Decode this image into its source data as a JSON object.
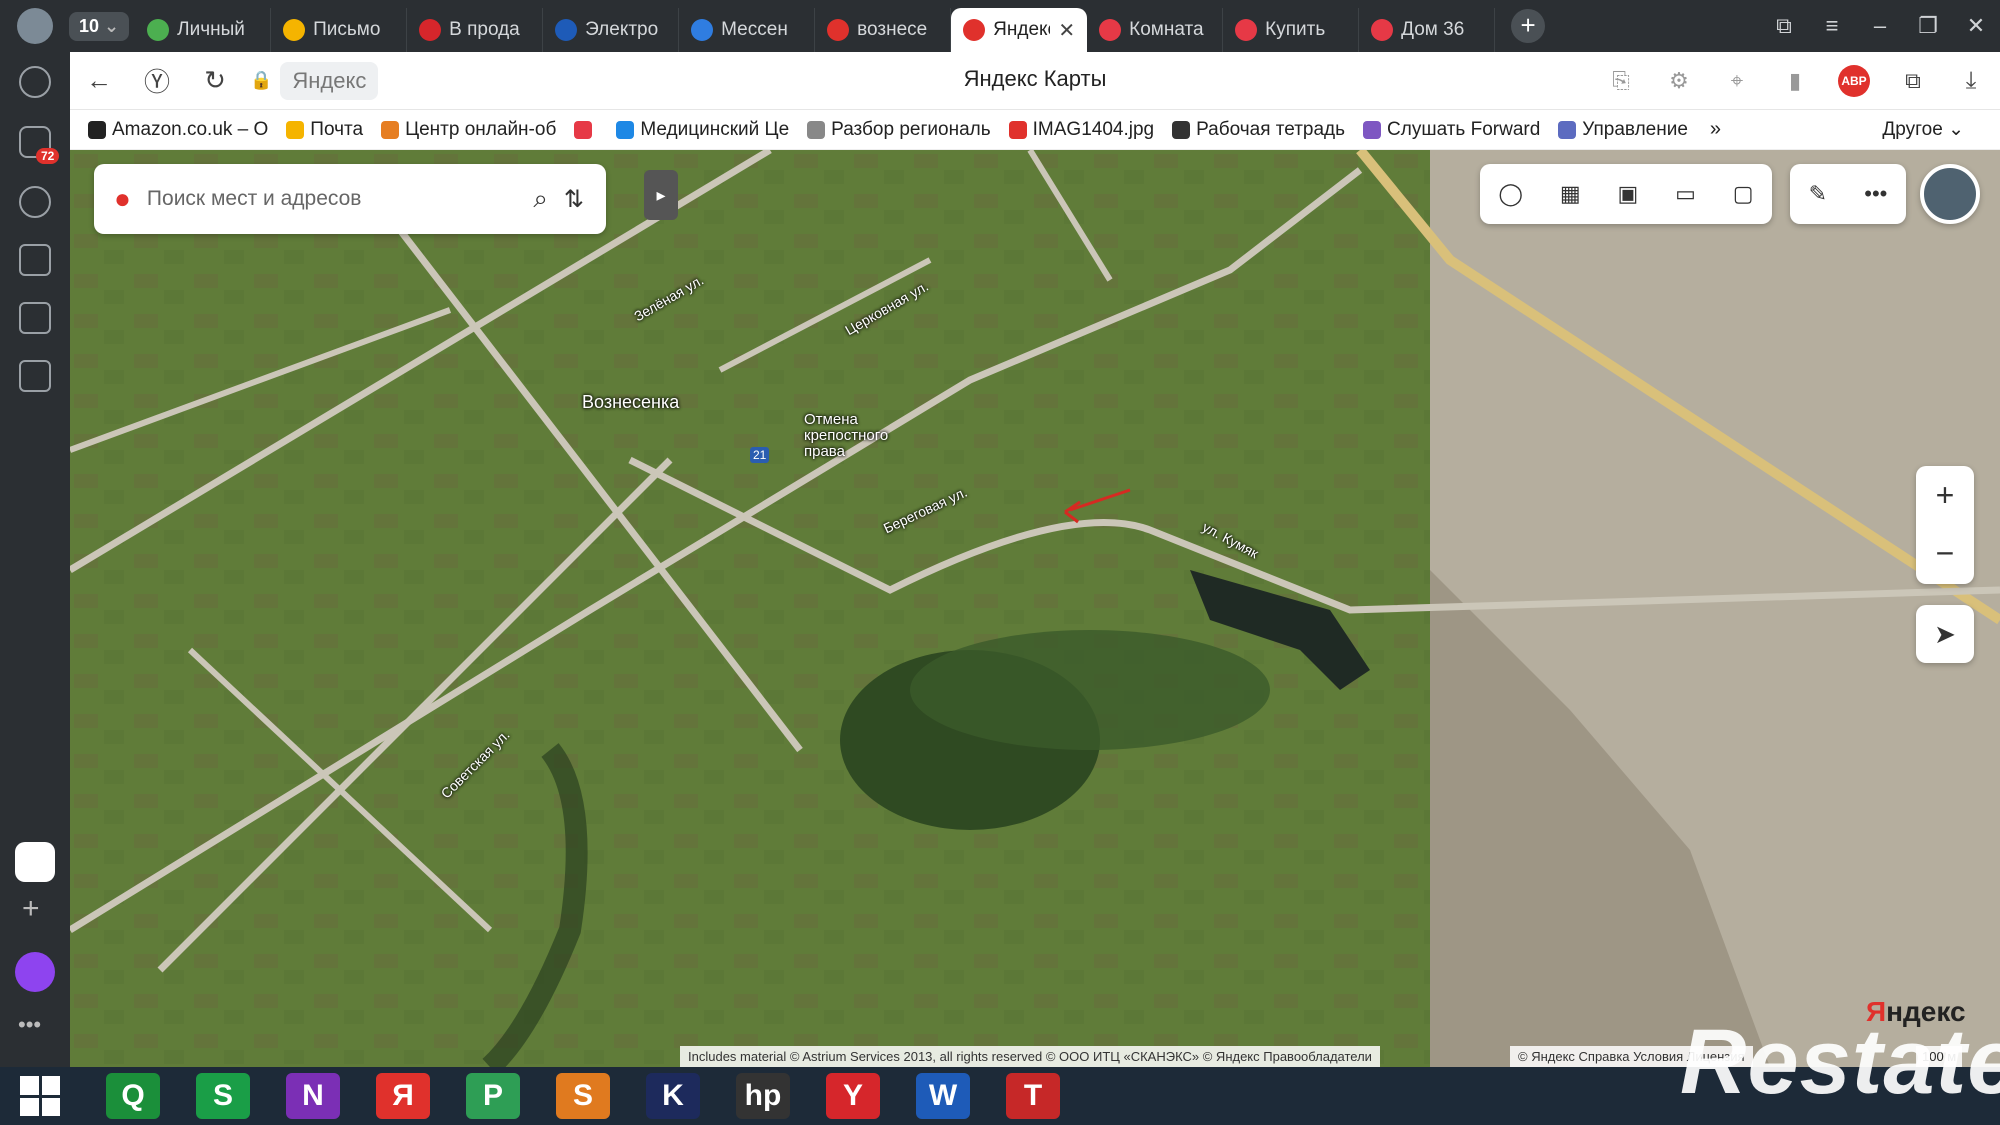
{
  "window": {
    "tab_count": "10"
  },
  "tabs": [
    {
      "label": "Личный",
      "color": "#4caf50"
    },
    {
      "label": "Письмо",
      "color": "#f5b400"
    },
    {
      "label": "В прода",
      "color": "#d6262b"
    },
    {
      "label": "Электро",
      "color": "#1e5bb8"
    },
    {
      "label": "Мессен",
      "color": "#2f7de1"
    },
    {
      "label": "вознесе",
      "color": "#e0312c"
    },
    {
      "label": "Яндекс",
      "color": "#e0312c",
      "active": true
    },
    {
      "label": "Комната",
      "color": "#e63946"
    },
    {
      "label": "Купить",
      "color": "#e63946"
    },
    {
      "label": "Дом 36",
      "color": "#e63946"
    }
  ],
  "address": {
    "url": "Яндекс",
    "title": "Яндекс Карты"
  },
  "bookmarks": [
    {
      "label": "Amazon.co.uk – O",
      "color": "#222222"
    },
    {
      "label": "Почта",
      "color": "#f5b400"
    },
    {
      "label": "Центр онлайн-об",
      "color": "#e67e22"
    },
    {
      "label": "",
      "color": "#e63946"
    },
    {
      "label": "Медицинский Це",
      "color": "#1e88e5"
    },
    {
      "label": "Разбор региональ",
      "color": "#888888"
    },
    {
      "label": "IMAG1404.jpg",
      "color": "#e0312c"
    },
    {
      "label": "Рабочая тетрадь",
      "color": "#333333"
    },
    {
      "label": "Слушать Forward",
      "color": "#7e57c2"
    },
    {
      "label": "Управление",
      "color": "#5c6bc0"
    }
  ],
  "bookmarks_more": "»",
  "bookmarks_other": "Другое",
  "map": {
    "search_placeholder": "Поиск мест и адресов",
    "labels": {
      "village": "Вознесенка",
      "monument": "Отмена крепостного права",
      "st_zelenaya": "Зелёная ул.",
      "st_tserkovnaya": "Церковная ул.",
      "st_beregovaya": "Береговая ул.",
      "st_kumyak": "ул. Кумяк",
      "st_sovetskaya": "Советская ул.",
      "route": "21"
    },
    "zoom_in": "+",
    "zoom_out": "−",
    "copyright": "Includes material © Astrium Services 2013, all rights reserved © ООО ИТЦ «СКАНЭКС» © Яндекс  Правообладатели",
    "links": "© Яндекс  Справка  Условия  Лицензия",
    "logo_ya": "Я",
    "logo_rest": "ндекс",
    "scale": "100 м"
  },
  "sidebar": {
    "notifications": "72"
  },
  "taskbar": {
    "items": [
      "Q",
      "S",
      "N",
      "Я",
      "P",
      "S",
      "K",
      "hp",
      "Y",
      "W",
      "T"
    ]
  },
  "watermark": "Restate"
}
